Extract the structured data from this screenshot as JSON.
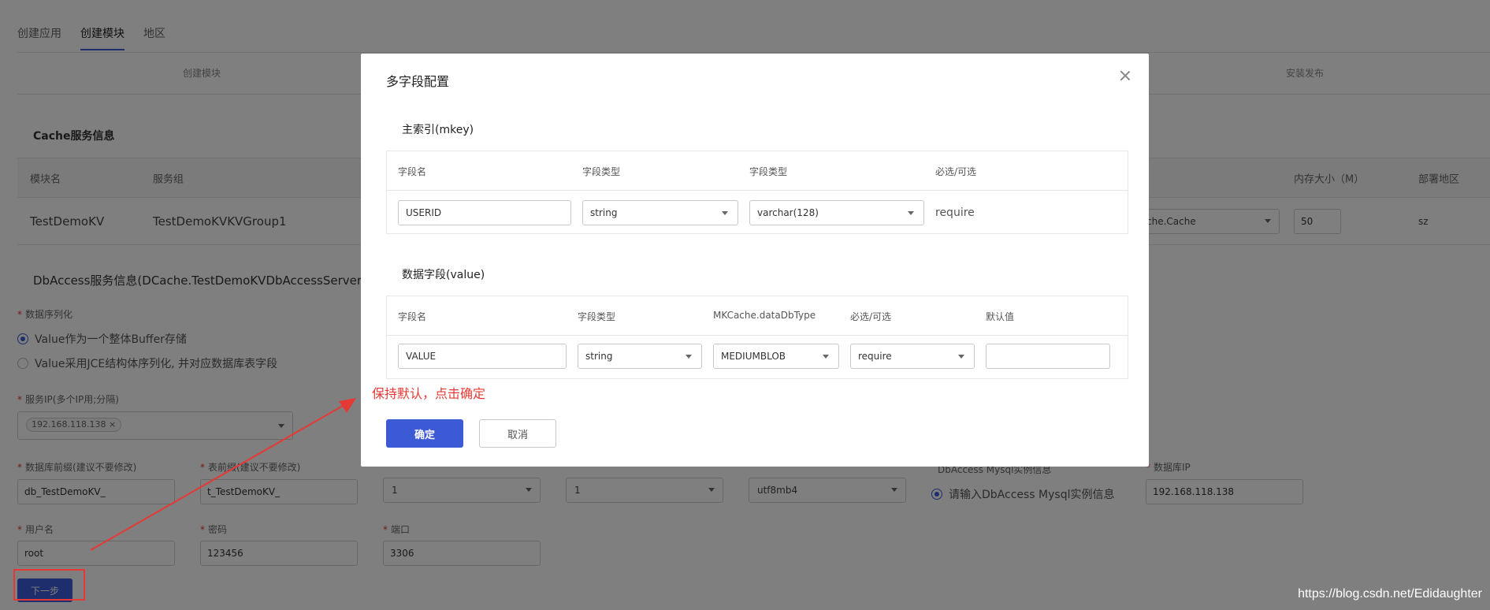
{
  "tabs": [
    "创建应用",
    "创建模块",
    "地区"
  ],
  "steps": [
    "创建模块",
    "安装发布"
  ],
  "cache_section": {
    "title": "Cache服务信息",
    "headers": [
      "模块名",
      "服务组",
      "内存大小（M）",
      "部署地区"
    ],
    "row": {
      "module": "TestDemoKV",
      "group": "TestDemoKVKVGroup1",
      "template": "che.Cache",
      "memory": "50",
      "region": "sz"
    }
  },
  "dbaccess_section": {
    "title": "DbAccess服务信息(DCache.TestDemoKVDbAccessServer.DbAcce",
    "serialize_label": "数据序列化",
    "serialize_options": [
      "Value作为一个整体Buffer存储",
      "Value采用JCE结构体序列化, 并对应数据库表字段"
    ],
    "ip_label": "服务IP(多个IP用;分隔)",
    "ip_tag": "192.168.118.138",
    "db_prefix_label": "数据库前缀(建议不要修改)",
    "db_prefix": "db_TestDemoKV_",
    "table_prefix_label": "表前缀(建议不要修改)",
    "table_prefix": "t_TestDemoKV_",
    "db_count": "1",
    "table_count": "1",
    "charset": "utf8mb4",
    "mysql_label": "DbAccess Mysql实例信息",
    "mysql_option": "请输入DbAccess Mysql实例信息",
    "db_ip_label": "数据库IP",
    "db_ip": "192.168.118.138",
    "user_label": "用户名",
    "user": "root",
    "pwd_label": "密码",
    "pwd": "123456",
    "port_label": "端口",
    "port": "3306",
    "next_label": "下一步"
  },
  "modal": {
    "title": "多字段配置",
    "mkey_title": "主索引(mkey)",
    "mkey_headers": [
      "字段名",
      "字段类型",
      "字段类型",
      "必选/可选"
    ],
    "mkey_row": {
      "name": "USERID",
      "type": "string",
      "db_type": "varchar(128)",
      "required": "require"
    },
    "value_title": "数据字段(value)",
    "value_headers": [
      "字段名",
      "字段类型",
      "MKCache.dataDbType",
      "必选/可选",
      "默认值"
    ],
    "value_row": {
      "name": "VALUE",
      "type": "string",
      "db_type": "MEDIUMBLOB",
      "required": "require",
      "default": ""
    },
    "ok_label": "确定",
    "cancel_label": "取消"
  },
  "annotation": "保持默认，点击确定",
  "watermark": "https://blog.csdn.net/Edidaughter",
  "colors": {
    "primary": "#3d5ad6",
    "annotation": "#e53935",
    "overlay": "rgba(0,0,0,0.5)"
  }
}
